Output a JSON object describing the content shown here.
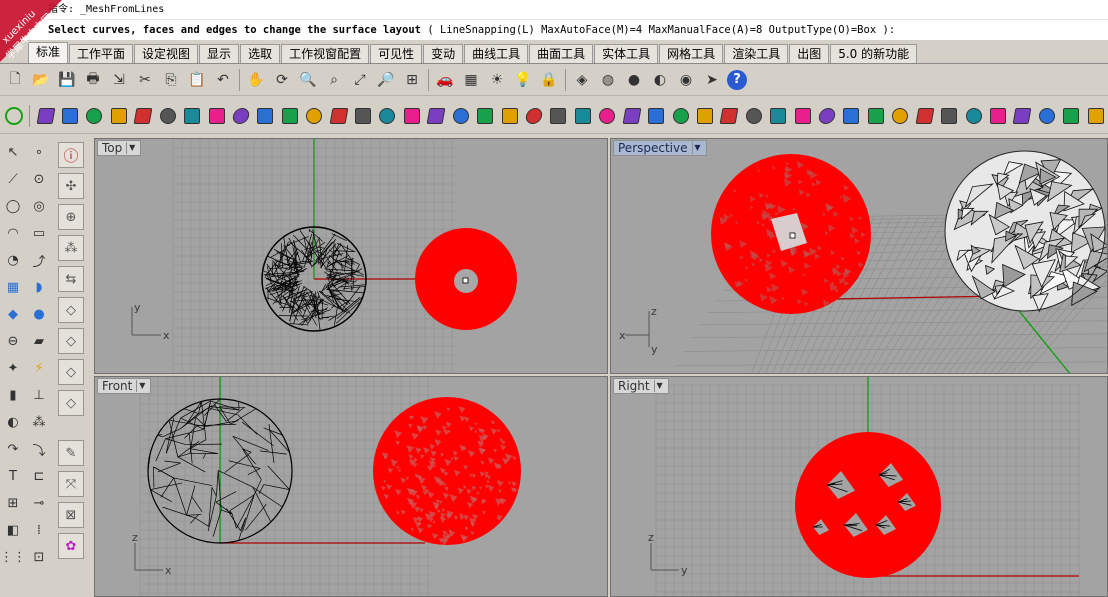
{
  "command": {
    "line1": "指令: _MeshFromLines",
    "line2_bold": "Select curves, faces and edges to change the surface layout",
    "line2_opts": "( LineSnapping(L)  MaxAutoFace(M)=4  MaxManualFace(A)=8  OutputType(O)=Box ):"
  },
  "watermark": {
    "line1": "xuexiniu",
    "line2": "学犀牛中文网"
  },
  "tabs": [
    {
      "label": "标准",
      "active": true
    },
    {
      "label": "工作平面"
    },
    {
      "label": "设定视图"
    },
    {
      "label": "显示"
    },
    {
      "label": "选取"
    },
    {
      "label": "工作视窗配置"
    },
    {
      "label": "可见性"
    },
    {
      "label": "变动"
    },
    {
      "label": "曲线工具"
    },
    {
      "label": "曲面工具"
    },
    {
      "label": "实体工具"
    },
    {
      "label": "网格工具"
    },
    {
      "label": "渲染工具"
    },
    {
      "label": "出图"
    },
    {
      "label": "5.0 的新功能"
    }
  ],
  "toolbar1": [
    "new-icon",
    "open-icon",
    "save-icon",
    "print-icon",
    "import-icon",
    "cut-icon",
    "copy-icon",
    "paste-icon",
    "undo-icon",
    "pan-icon",
    "rotate-view-icon",
    "zoom-dynamic-icon",
    "zoom-window-icon",
    "zoom-extents-icon",
    "zoom-selected-icon",
    "four-viewports-icon",
    "car-icon",
    "named-view-icon",
    "sun-icon",
    "light-bulb-icon",
    "lock-icon",
    "layer-icon",
    "color-wheel-icon",
    "render-sphere-icon",
    "shaded-sphere-icon",
    "rendered-sphere-icon",
    "cursor-icon",
    "help-icon"
  ],
  "toolbar2": [
    "power-icon",
    "mesh-box-icon",
    "mesh-sphere-icon",
    "mesh-loop-icon",
    "mesh-patch-icon",
    "mesh-cylinder-icon",
    "mesh-plane-icon",
    "mesh-weld-icon",
    "mesh-unweld-icon",
    "mesh-fill-holes-icon",
    "mesh-extract-icon",
    "mesh-split-icon",
    "mesh-join-icon",
    "mesh-explode-icon",
    "mesh-boolean-icon",
    "mesh-offset-icon",
    "mesh-reduce-icon",
    "mesh-triangulate-icon",
    "mesh-quad-icon",
    "mesh-cull-icon",
    "mesh-flip-icon",
    "mesh-select-icon",
    "mesh-repair-icon",
    "mesh-delete-icon",
    "mesh-align-icon",
    "mesh-smooth-icon",
    "mesh-refine-icon",
    "mesh-collapse-icon",
    "mesh-swap-icon",
    "mesh-point-icon",
    "mesh-wire-icon",
    "mesh-outline-icon",
    "mesh-project-icon",
    "mesh-pull-icon",
    "mesh-flow-icon",
    "mesh-morph-icon",
    "mesh-twist-icon",
    "mesh-bend-icon",
    "mesh-taper-icon",
    "mesh-shear-icon",
    "mesh-star-icon",
    "mesh-pentagon-icon",
    "mesh-heat-icon",
    "mesh-export-icon",
    "mesh-edges-icon"
  ],
  "viewports": {
    "top": {
      "label": "Top",
      "x_axis": "x",
      "y_axis": "y"
    },
    "perspective": {
      "label": "Perspective",
      "axis_z": "z",
      "axis_y": "y",
      "axis_x": "x"
    },
    "front": {
      "label": "Front",
      "x_axis": "x",
      "z_axis": "z"
    },
    "right": {
      "label": "Right",
      "y_axis": "y",
      "z_axis": "z"
    }
  },
  "colors": {
    "viewport_bg": "#a3a3a3",
    "grid": "#8e8e8e",
    "mesh_red": "#ff0000",
    "mesh_black": "#000000",
    "axis_green": "#00a000",
    "axis_red": "#b00000"
  }
}
